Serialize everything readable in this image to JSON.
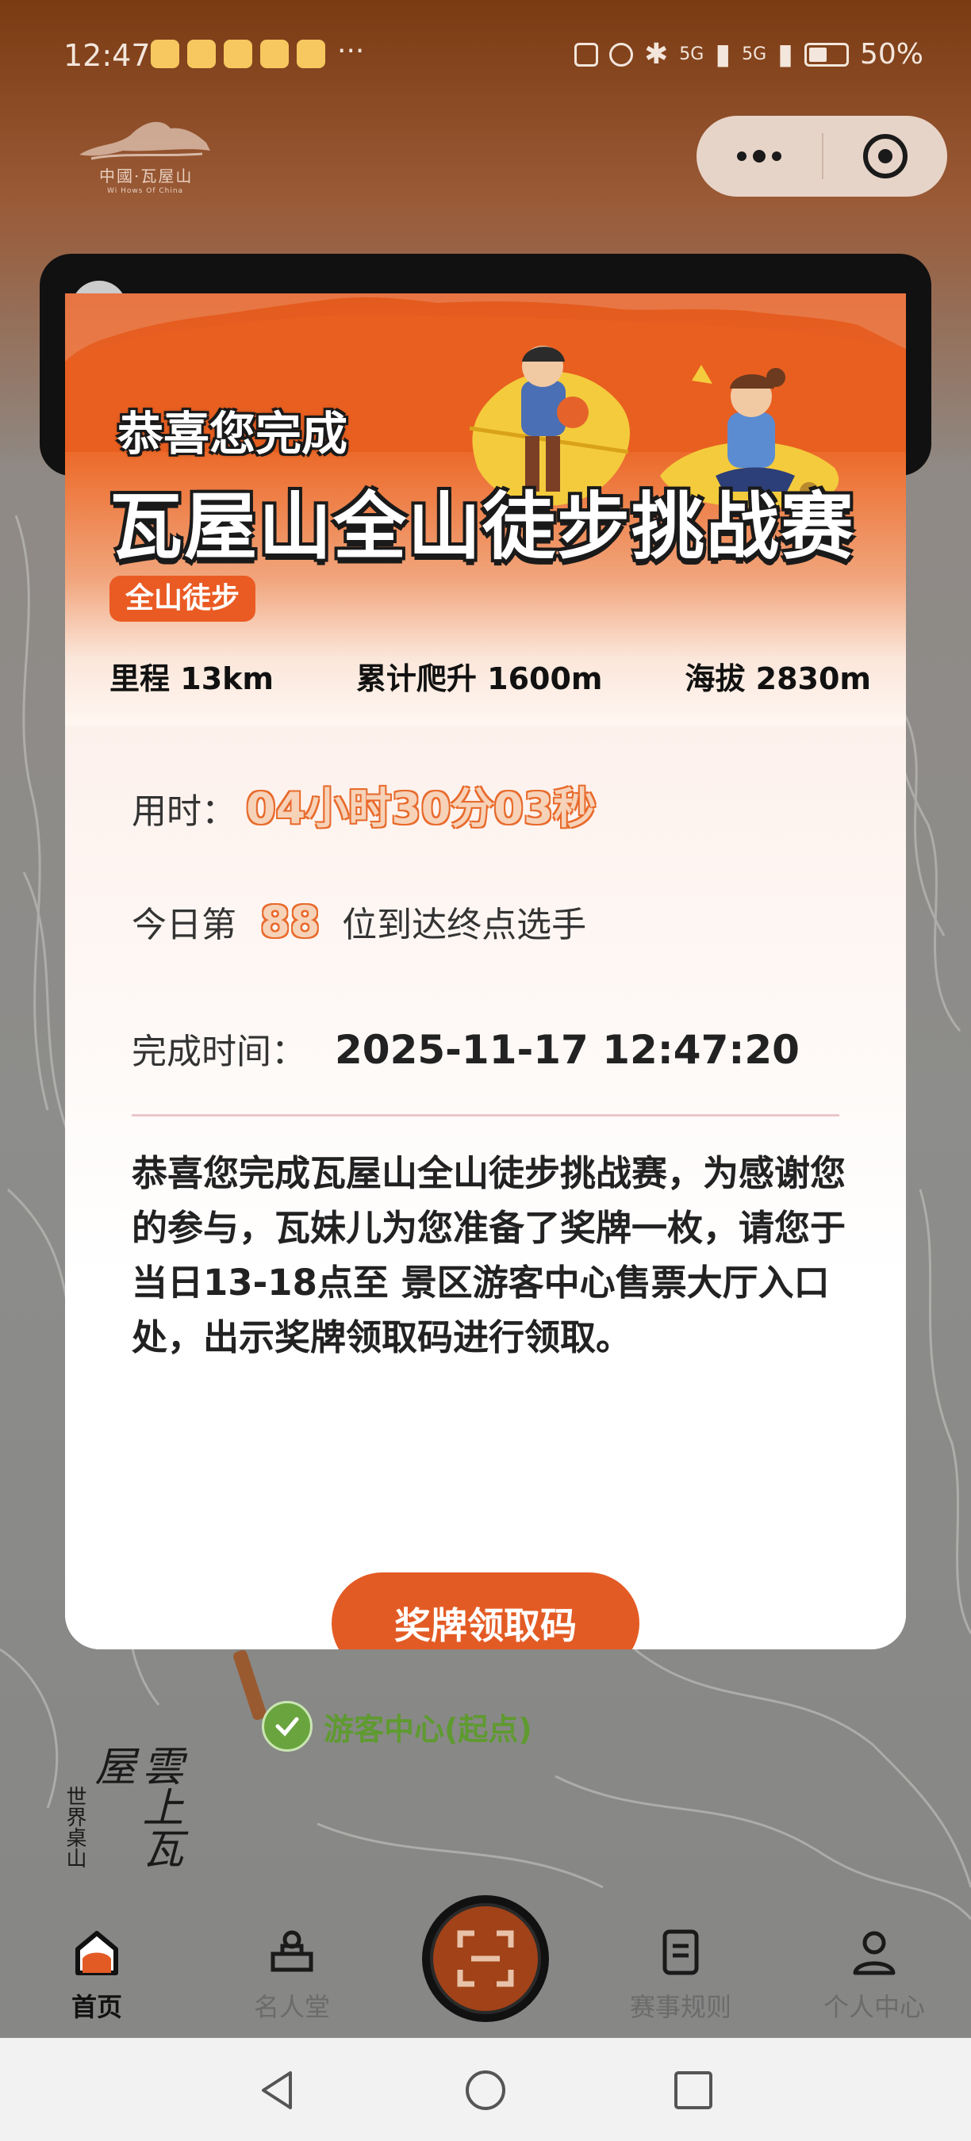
{
  "status_bar": {
    "time": "12:47",
    "more": "···",
    "battery": "50%",
    "network": "5G"
  },
  "header": {
    "logo_text": "中國·瓦屋山",
    "logo_sub": "Wi Hows Of China"
  },
  "modal": {
    "congrats": "恭喜您完成",
    "event_title": "瓦屋山全山徒步挑战赛",
    "tag": "全山徒步",
    "stats": [
      {
        "label": "里程",
        "value": "13km"
      },
      {
        "label": "累计爬升",
        "value": "1600m"
      },
      {
        "label": "海拔",
        "value": "2830m"
      }
    ],
    "time_label": "用时：",
    "time_value": "04小时30分03秒",
    "rank_prefix": "今日第",
    "rank_value": "88",
    "rank_suffix": "位到达终点选手",
    "finish_label": "完成时间：",
    "finish_value": "2025-11-17 12:47:20",
    "message": "恭喜您完成瓦屋山全山徒步挑战赛，为感谢您的参与，瓦妹儿为您准备了奖牌一枚，请您于当日13-18点至 景区游客中心售票大厅入口处，出示奖牌领取码进行领取。",
    "button": "奖牌领取码"
  },
  "map": {
    "start_label": "游客中心(起点)",
    "calligraphy_small": "世界桌山",
    "calligraphy_big": "雲上瓦屋"
  },
  "nav": {
    "home": "首页",
    "hall": "名人堂",
    "rules": "赛事规则",
    "profile": "个人中心"
  },
  "colors": {
    "accent": "#e35b24",
    "start_green": "#6aa43f"
  }
}
